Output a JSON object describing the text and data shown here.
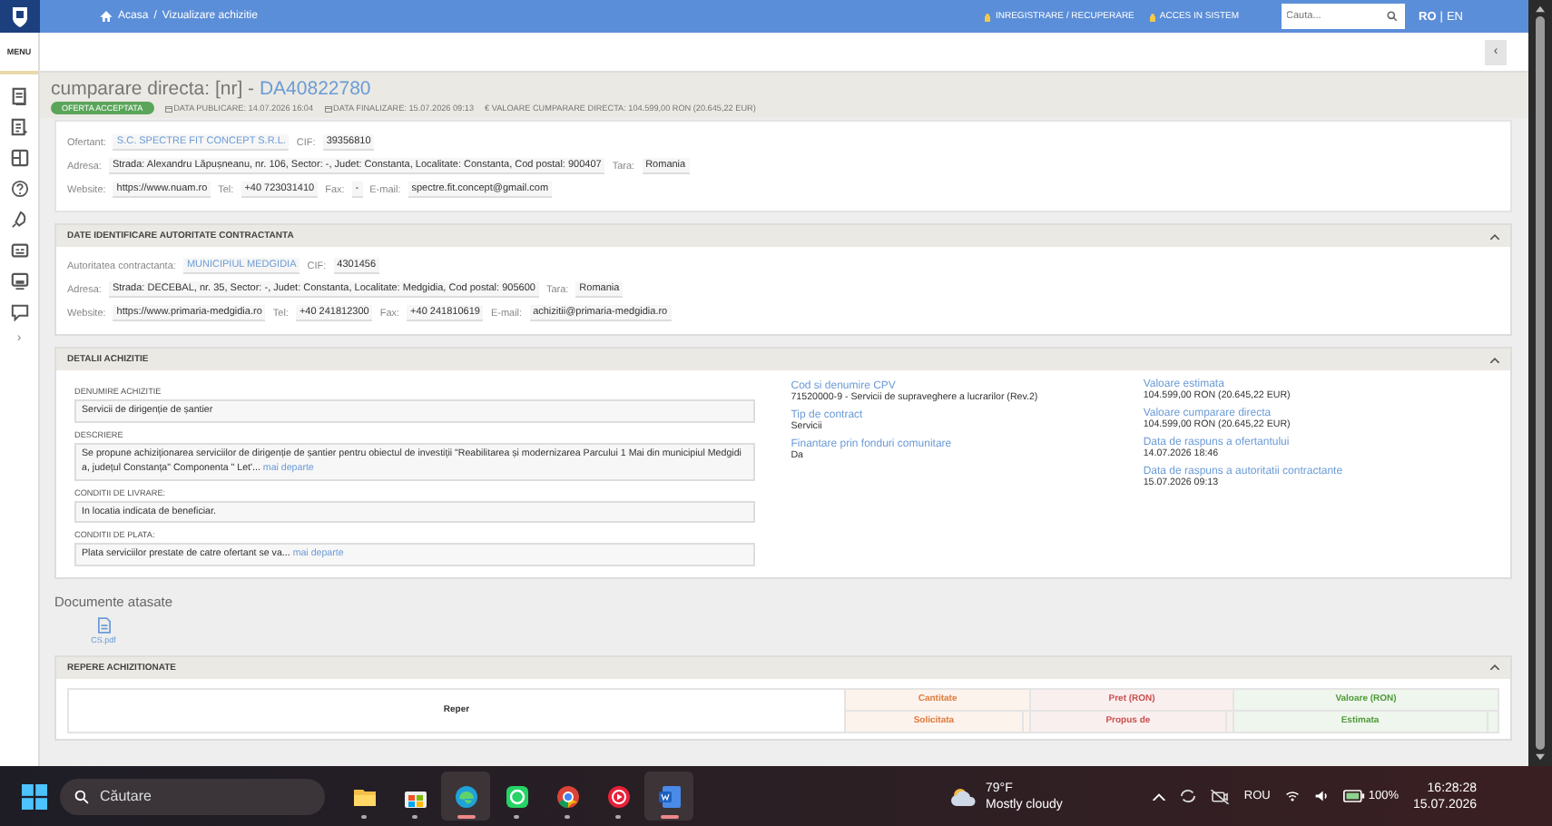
{
  "topbar": {
    "breadcrumb": [
      "Acasa",
      "Vizualizare achizitie"
    ],
    "separator": "/",
    "links": [
      "INREGISTRARE / RECUPERARE",
      "ACCES IN SISTEM"
    ],
    "search": {
      "placeholder": "Cauta..."
    },
    "languages": [
      {
        "label": "RO",
        "selected": true
      },
      {
        "label": "EN",
        "selected": false
      }
    ],
    "language_separator": "|"
  },
  "sidebar": {
    "menu_label": "MENU",
    "expand": "›"
  },
  "toolbar": {
    "collapse_button": "‹"
  },
  "header": {
    "title": "cumparare directa: [nr] - ",
    "code": "DA40822780",
    "status": "OFERTA ACCEPTATA",
    "meta": [
      {
        "kind": "calendar",
        "label": "DATA PUBLICARE:",
        "value": "14.07.2026 16:04"
      },
      {
        "kind": "calendar",
        "label": "DATA FINALIZARE:",
        "value": "15.07.2026 09:13"
      },
      {
        "kind": "currency",
        "symbol": "€",
        "label": "VALOARE CUMPARARE DIRECTA:",
        "value": "104.599,00  RON (20.645,22  EUR)"
      }
    ]
  },
  "offerer": {
    "lines": [
      {
        "fields": [
          {
            "label": "Ofertant:",
            "value": "S.C. SPECTRE FIT CONCEPT S.R.L.",
            "link": true
          },
          {
            "label": "CIF:",
            "value": "39356810",
            "link": false
          }
        ]
      },
      {
        "fields": [
          {
            "label": "Adresa:",
            "value": "Strada: Alexandru Lăpușneanu, nr. 106, Sector: -, Judet: Constanta, Localitate: Constanta, Cod postal: 900407",
            "link": false
          },
          {
            "label": "Tara:",
            "value": "Romania",
            "link": false
          }
        ]
      },
      {
        "fields": [
          {
            "label": "Website:",
            "value": "https://www.nuam.ro",
            "link": false
          },
          {
            "label": "Tel:",
            "value": "+40 723031410",
            "link": false
          },
          {
            "label": "Fax:",
            "value": "-",
            "link": false
          },
          {
            "label": "E-mail:",
            "value": "spectre.fit.concept@gmail.com",
            "link": false
          }
        ]
      }
    ]
  },
  "authority": {
    "title": "DATE IDENTIFICARE AUTORITATE CONTRACTANTA",
    "expanded": true,
    "lines": [
      {
        "fields": [
          {
            "label": "Autoritatea contractanta:",
            "value": "MUNICIPIUL MEDGIDIA",
            "link": true
          },
          {
            "label": "CIF:",
            "value": "4301456",
            "link": false
          }
        ]
      },
      {
        "fields": [
          {
            "label": "Adresa:",
            "value": "Strada: DECEBAL, nr. 35, Sector: -, Judet: Constanta, Localitate: Medgidia, Cod postal: 905600",
            "link": false
          },
          {
            "label": "Tara:",
            "value": "Romania",
            "link": false
          }
        ]
      },
      {
        "fields": [
          {
            "label": "Website:",
            "value": "https://www.primaria-medgidia.ro",
            "link": false
          },
          {
            "label": "Tel:",
            "value": "+40 241812300",
            "link": false
          },
          {
            "label": "Fax:",
            "value": "+40 241810619",
            "link": false
          },
          {
            "label": "E-mail:",
            "value": "achizitii@primaria-medgidia.ro",
            "link": false
          }
        ]
      }
    ]
  },
  "details": {
    "title": "DETALII ACHIZITIE",
    "expanded": true,
    "fields": [
      {
        "label": "DENUMIRE ACHIZITIE",
        "value": "Servicii de dirigenție de șantier"
      },
      {
        "label": "DESCRIERE",
        "value": "Se propune achiziționarea serviciilor de dirigenție de șantier pentru obiectul de investiții \"Reabilitarea și modernizarea Parcului 1 Mai din municipiul Medgidia, județul Constanța\" Componenta \" Let'...",
        "more": "mai departe"
      },
      {
        "label": "CONDITII DE LIVRARE:",
        "value": "In locatia indicata de beneficiar."
      },
      {
        "label": "CONDITII DE PLATA:",
        "value": "Plata serviciilor prestate de catre ofertant se va...",
        "more": "mai departe"
      }
    ],
    "columns": [
      [
        {
          "label": "Cod si denumire CPV",
          "value": "71520000-9 - Servicii de supraveghere a lucrarilor (Rev.2)"
        },
        {
          "label": "Tip de contract",
          "value": "Servicii"
        },
        {
          "label": "Finantare prin fonduri comunitare",
          "value": "Da"
        }
      ],
      [
        {
          "label": "Valoare estimata",
          "value": "104.599,00  RON (20.645,22  EUR)"
        },
        {
          "label": "Valoare cumparare directa",
          "value": "104.599,00  RON (20.645,22  EUR)"
        },
        {
          "label": "Data de raspuns a ofertantului",
          "value": "14.07.2026 18:46"
        },
        {
          "label": "Data de raspuns a autoritatii contractante",
          "value": "15.07.2026 09:13"
        }
      ]
    ]
  },
  "documents": {
    "title": "Documente atasate",
    "files": [
      "CS.pdf"
    ]
  },
  "items_table": {
    "title": "REPERE ACHIZITIONATE",
    "expanded": true,
    "first_column": "Reper",
    "groups": [
      {
        "label": "Cantitate",
        "color": "#e07a3c",
        "subcolumn": "Solicitata"
      },
      {
        "label": "Pret (RON)",
        "color": "#c9514f",
        "subcolumn": "Propus de"
      },
      {
        "label": "Valoare (RON)",
        "color": "#4f9a3a",
        "subcolumn": "Estimata"
      }
    ]
  },
  "taskbar": {
    "search": {
      "placeholder": "Căutare"
    },
    "apps": [
      {
        "kind": "folder",
        "active": false
      },
      {
        "kind": "store",
        "active": false
      },
      {
        "kind": "edge",
        "active": true
      },
      {
        "kind": "whatsapp",
        "active": false
      },
      {
        "kind": "chrome",
        "active": false
      },
      {
        "kind": "music",
        "active": false
      },
      {
        "kind": "word",
        "active": true
      }
    ],
    "weather": {
      "temperature": "79°F",
      "condition": "Mostly cloudy"
    },
    "language": "ROU",
    "battery": "100%",
    "time": "16:28:28",
    "date": "15.07.2026"
  }
}
